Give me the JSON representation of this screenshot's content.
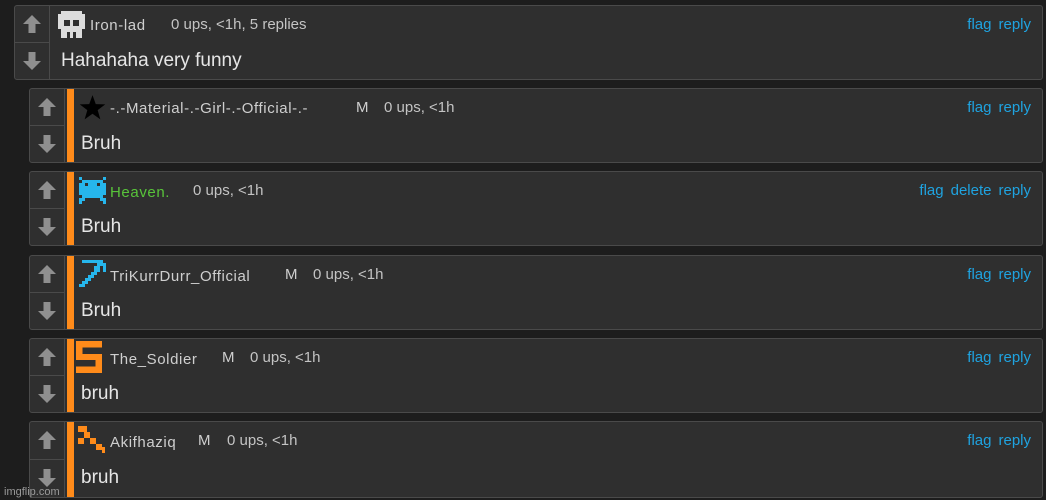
{
  "comments": [
    {
      "user": "Iron-lad",
      "mod": "",
      "meta": "0 ups, <1h, 5 replies",
      "body": "Hahahaha very funny",
      "actions": [
        "flag",
        "reply"
      ],
      "avatar": "skull-avatar-icon"
    },
    {
      "user": "-.-Material-.-Girl-.-Official-.-",
      "mod": "M",
      "meta": "0 ups, <1h",
      "body": "Bruh",
      "actions": [
        "flag",
        "reply"
      ],
      "avatar": "star-avatar-icon"
    },
    {
      "user": "Heaven.",
      "mod": "",
      "meta": "0 ups, <1h",
      "body": "Bruh",
      "actions": [
        "flag",
        "delete",
        "reply"
      ],
      "avatar": "pixel-invader-avatar-icon"
    },
    {
      "user": "TriKurrDurr_Official",
      "mod": "M",
      "meta": "0 ups, <1h",
      "body": "Bruh",
      "actions": [
        "flag",
        "reply"
      ],
      "avatar": "pickaxe-avatar-icon"
    },
    {
      "user": "The_Soldier",
      "mod": "M",
      "meta": "0 ups, <1h",
      "body": "bruh",
      "actions": [
        "flag",
        "reply"
      ],
      "avatar": "s-letter-avatar-icon"
    },
    {
      "user": "Akifhaziq",
      "mod": "M",
      "meta": "0 ups, <1h",
      "body": "bruh",
      "actions": [
        "flag",
        "reply"
      ],
      "avatar": "pixel-arrow-avatar-icon"
    }
  ],
  "watermark": "imgflip.com",
  "colors": {
    "accent_bar": "#ff8b1a",
    "link": "#1fa3e0",
    "username_green": "#58c43a",
    "panel": "#2f2f2f",
    "background": "#1d1d1d"
  }
}
